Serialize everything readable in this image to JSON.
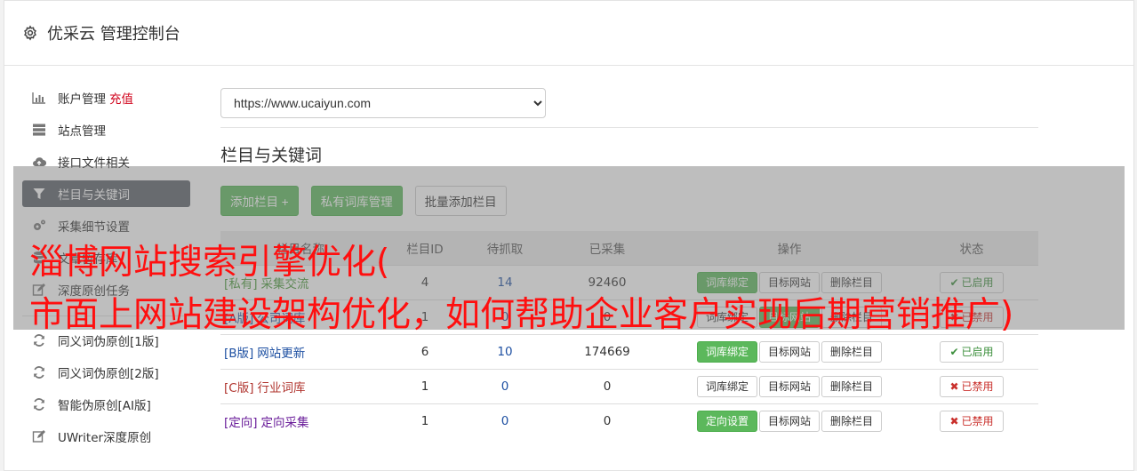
{
  "header": {
    "title": "优采云 管理控制台"
  },
  "sidebar": {
    "items": [
      {
        "label": "账户管理",
        "badge": "充值",
        "icon": "bar-chart-icon"
      },
      {
        "label": "站点管理",
        "icon": "server-icon"
      },
      {
        "label": "接口文件相关",
        "icon": "cloud-upload-icon"
      },
      {
        "label": "栏目与关键词",
        "icon": "filter-icon",
        "active": true
      },
      {
        "label": "采集细节设置",
        "icon": "gears-icon"
      },
      {
        "label": "文章暂存库",
        "icon": "database-icon"
      },
      {
        "label": "深度原创任务",
        "icon": "edit-icon"
      }
    ],
    "items2": [
      {
        "label": "同义词伪原创[1版]",
        "icon": "refresh-icon"
      },
      {
        "label": "同义词伪原创[2版]",
        "icon": "refresh-icon"
      },
      {
        "label": "智能伪原创[AI版]",
        "icon": "refresh-icon"
      },
      {
        "label": "UWriter深度原创",
        "icon": "edit-icon"
      }
    ]
  },
  "main": {
    "site_select": "https://www.ucaiyun.com",
    "section_title": "栏目与关键词",
    "buttons": {
      "add_column": "添加栏目 +",
      "private_lib": "私有词库管理",
      "batch_add": "批量添加栏目"
    },
    "table": {
      "headers": [
        "栏目名称",
        "栏目ID",
        "待抓取",
        "已采集",
        "操作",
        "状态"
      ],
      "rows": [
        {
          "tag": "[私有]",
          "name": "采集交流",
          "color": "#4a9a3a",
          "id": "4",
          "pending": "14",
          "collected": "92460",
          "action1": "词库绑定",
          "action1_green": true,
          "action2": "目标网站",
          "action3": "删除栏目",
          "status": "已启用",
          "on": true
        },
        {
          "tag": "[A版]",
          "name": "公司词库",
          "color": "#1e50a2",
          "id": "1",
          "pending": "0",
          "collected": "0",
          "action1": "词库绑定",
          "action1_green": false,
          "action2": "目标网站",
          "action2_green": true,
          "action3": "删除栏目",
          "status": "已禁用",
          "on": false
        },
        {
          "tag": "[B版]",
          "name": "网站更新",
          "color": "#1e50a2",
          "id": "6",
          "pending": "10",
          "collected": "174669",
          "action1": "词库绑定",
          "action1_green": true,
          "action2": "目标网站",
          "action3": "删除栏目",
          "status": "已启用",
          "on": true
        },
        {
          "tag": "[C版]",
          "name": "行业词库",
          "color": "#b0342e",
          "id": "1",
          "pending": "0",
          "collected": "0",
          "action1": "词库绑定",
          "action1_green": false,
          "action2": "目标网站",
          "action3": "删除栏目",
          "status": "已禁用",
          "on": false
        },
        {
          "tag": "[定向]",
          "name": "定向采集",
          "color": "#6a1d9a",
          "id": "1",
          "pending": "0",
          "collected": "0",
          "action1": "定向设置",
          "action1_green": true,
          "action2": "目标网站",
          "action3": "删除栏目",
          "status": "已禁用",
          "on": false
        }
      ]
    }
  },
  "overlay": {
    "line1": "淄博网站搜索引擎优化(",
    "line2": "市面上网站建设架构优化，如何帮助企业客户实现后期营销推广)"
  }
}
